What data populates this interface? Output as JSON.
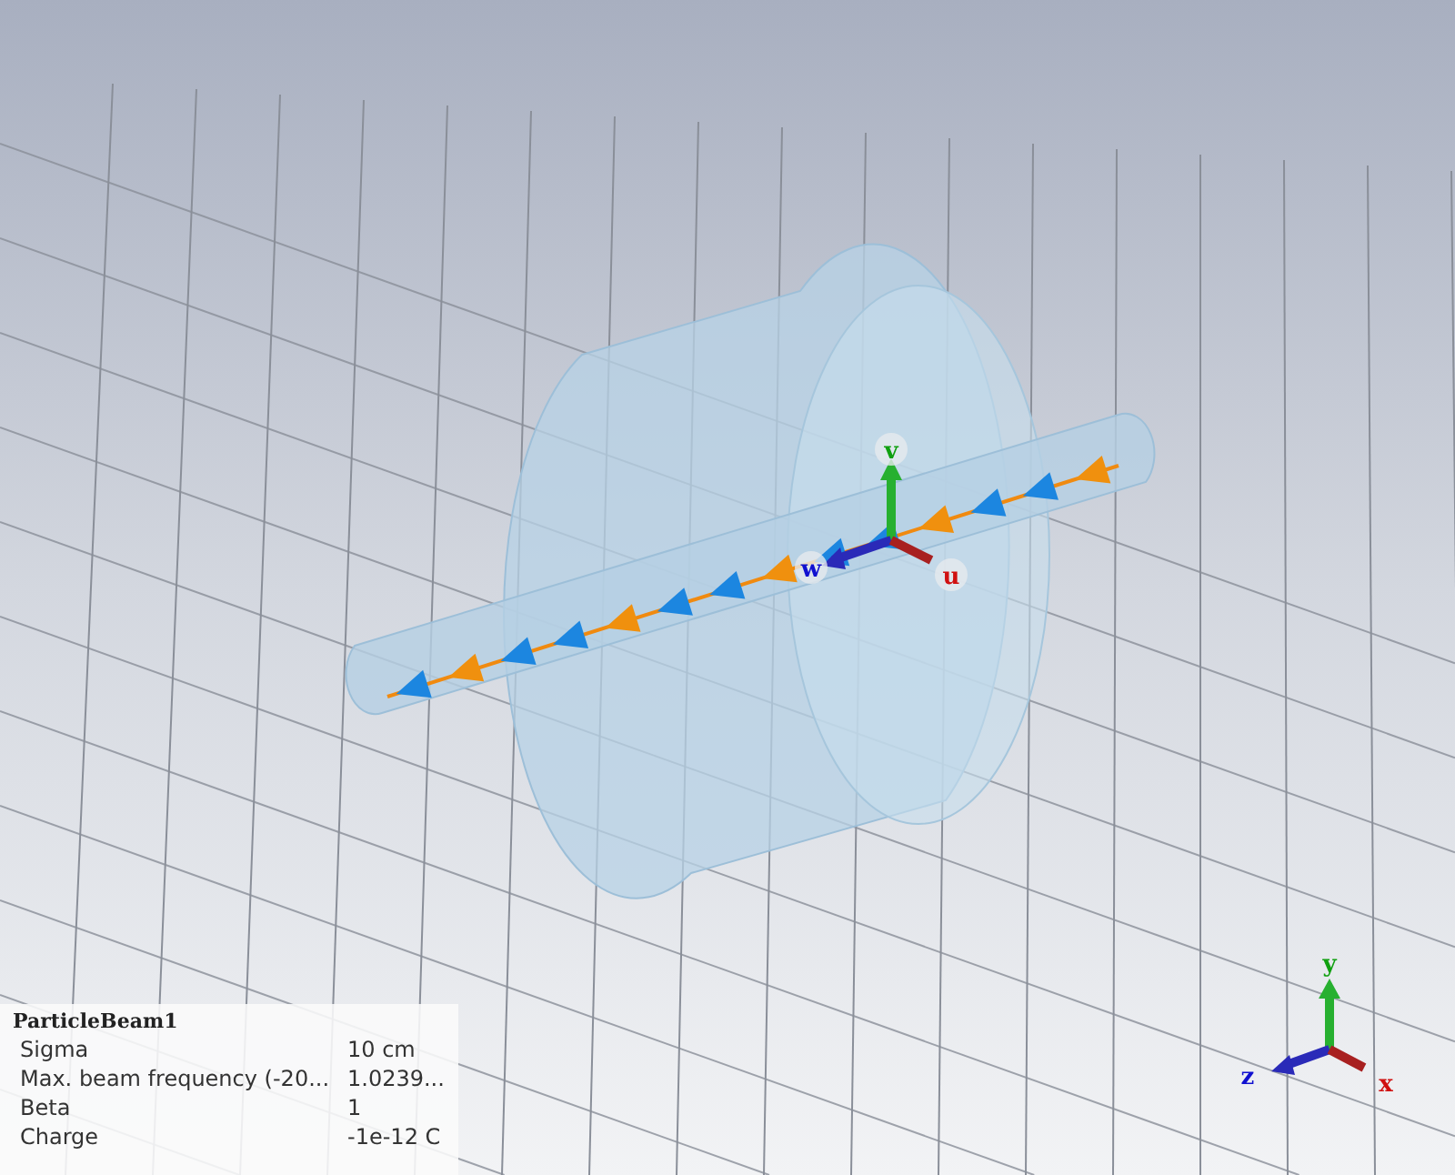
{
  "viewport": {
    "local_axes": {
      "u": "u",
      "v": "v",
      "w": "w"
    },
    "global_axes": {
      "x": "x",
      "y": "y",
      "z": "z"
    }
  },
  "info_panel": {
    "title": "ParticleBeam1",
    "rows": [
      {
        "name": "Sigma",
        "value": "10 cm"
      },
      {
        "name": "Max. beam frequency (-20...",
        "value": "1.0239..."
      },
      {
        "name": "Beta",
        "value": "1"
      },
      {
        "name": "Charge",
        "value": "-1e-12 C"
      }
    ]
  }
}
